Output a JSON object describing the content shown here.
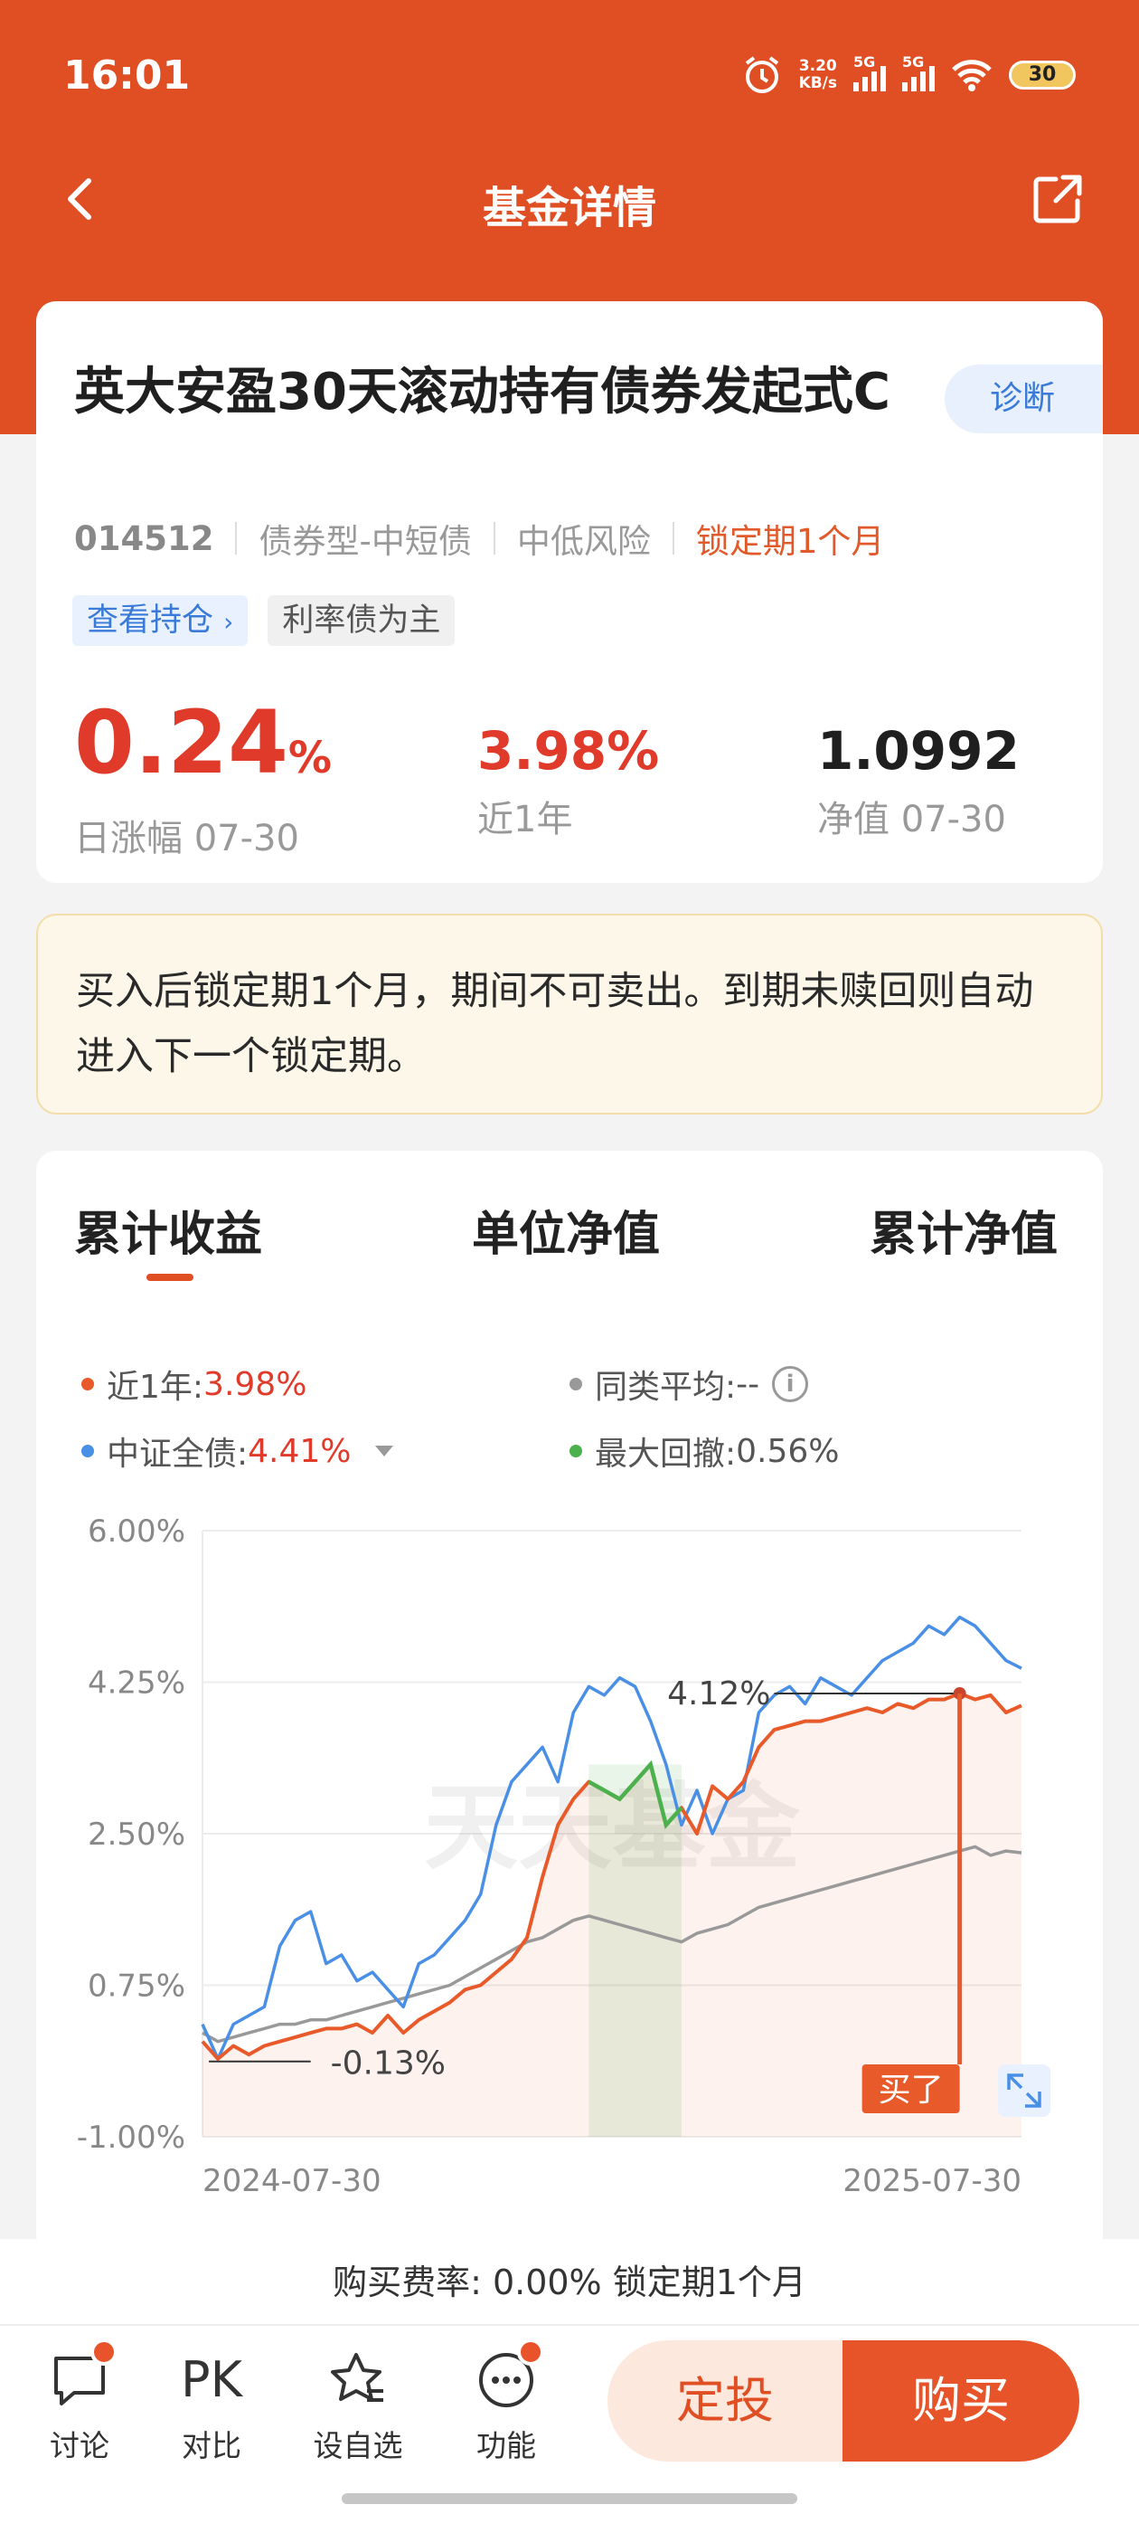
{
  "status_bar": {
    "time": "16:01",
    "net_speed": "3.20",
    "net_unit": "KB/s",
    "sig1": "5G",
    "sig2": "5G",
    "battery": "30"
  },
  "nav": {
    "title": "基金详情"
  },
  "fund": {
    "name": "英大安盈30天滚动持有债券发起式C",
    "diagnose": "诊断",
    "code": "014512",
    "type": "债券型-中短债",
    "risk": "中低风险",
    "lock": "锁定期1个月",
    "tags": [
      "查看持仓",
      "利率债为主"
    ],
    "daily_change": "0.24",
    "daily_change_unit": "%",
    "daily_change_label": "日涨幅 07-30",
    "year_return": "3.98%",
    "year_label": "近1年",
    "nav": "1.0992",
    "nav_label": "净值 07-30"
  },
  "notice": "买入后锁定期1个月，期间不可卖出。到期未赎回则自动进入下一个锁定期。",
  "chart_tabs": [
    "累计收益",
    "单位净值",
    "累计净值"
  ],
  "legend": {
    "fund_label": "近1年:",
    "fund_value": "3.98%",
    "avg_label": "同类平均:",
    "avg_value": "--",
    "bench_label": "中证全债:",
    "bench_value": "4.41%",
    "dd_label": "最大回撤:",
    "dd_value": "0.56%"
  },
  "colors": {
    "fund": "#e85a2a",
    "benchmark": "#4a8fe6",
    "average": "#999999",
    "drawdown": "#4cb04c"
  },
  "chart_data": {
    "type": "line",
    "ylim": [
      -1.0,
      6.0
    ],
    "y_ticks": [
      "6.00%",
      "4.25%",
      "2.50%",
      "0.75%",
      "-1.00%"
    ],
    "x_start": "2024-07-30",
    "x_end": "2025-07-30",
    "watermark": "天天基金",
    "annotations": {
      "max": "4.12%",
      "min": "-0.13%",
      "buy": "买了"
    },
    "series": [
      {
        "name": "近1年",
        "values": [
          0.1,
          -0.1,
          0.05,
          -0.05,
          0.05,
          0.1,
          0.15,
          0.2,
          0.25,
          0.25,
          0.3,
          0.2,
          0.4,
          0.2,
          0.35,
          0.45,
          0.55,
          0.7,
          0.75,
          0.9,
          1.05,
          1.3,
          2.0,
          2.6,
          2.9,
          3.1,
          3.0,
          2.9,
          3.1,
          3.3,
          2.6,
          2.8,
          2.5,
          3.05,
          2.9,
          3.1,
          3.5,
          3.7,
          3.75,
          3.8,
          3.8,
          3.85,
          3.9,
          3.95,
          3.9,
          4.0,
          3.95,
          4.05,
          4.05,
          4.12,
          4.05,
          4.1,
          3.9,
          3.98
        ]
      },
      {
        "name": "中证全债",
        "values": [
          0.3,
          -0.1,
          0.3,
          0.4,
          0.5,
          1.2,
          1.5,
          1.6,
          1.0,
          1.1,
          0.8,
          0.9,
          0.7,
          0.5,
          1.0,
          1.1,
          1.3,
          1.5,
          1.8,
          2.6,
          3.1,
          3.3,
          3.5,
          3.1,
          3.9,
          4.2,
          4.1,
          4.3,
          4.2,
          3.8,
          3.3,
          2.6,
          3.0,
          2.5,
          2.9,
          3.0,
          3.9,
          4.1,
          4.2,
          4.0,
          4.3,
          4.2,
          4.1,
          4.3,
          4.5,
          4.6,
          4.7,
          4.9,
          4.8,
          5.0,
          4.9,
          4.7,
          4.5,
          4.41
        ]
      },
      {
        "name": "同类平均",
        "values": [
          0.2,
          0.1,
          0.15,
          0.2,
          0.25,
          0.3,
          0.3,
          0.35,
          0.35,
          0.4,
          0.45,
          0.5,
          0.55,
          0.6,
          0.65,
          0.7,
          0.75,
          0.85,
          0.95,
          1.05,
          1.15,
          1.25,
          1.3,
          1.4,
          1.5,
          1.55,
          1.5,
          1.45,
          1.4,
          1.35,
          1.3,
          1.25,
          1.35,
          1.4,
          1.45,
          1.55,
          1.65,
          1.7,
          1.75,
          1.8,
          1.85,
          1.9,
          1.95,
          2.0,
          2.05,
          2.1,
          2.15,
          2.2,
          2.25,
          2.3,
          2.35,
          2.25,
          2.3,
          2.28
        ]
      }
    ]
  },
  "fee_bar": "购买费率: 0.00% 锁定期1个月",
  "bottom": {
    "discuss": "讨论",
    "pk_icon": "PK",
    "compare": "对比",
    "watchlist": "设自选",
    "functions": "功能",
    "dingtou": "定投",
    "buy": "购买"
  }
}
